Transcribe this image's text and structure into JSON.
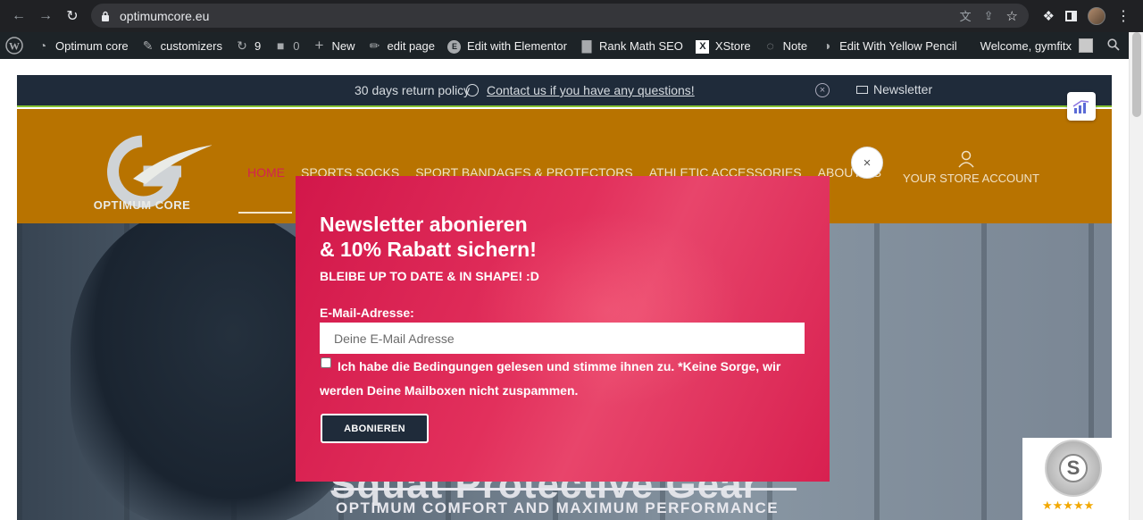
{
  "browser": {
    "url": "optimumcore.eu"
  },
  "adminbar": {
    "site_name": "Optimum core",
    "customizers": "customizers",
    "updates_count": "9",
    "comments_count": "0",
    "new": "New",
    "edit_page": "edit page",
    "elementor": "Edit with Elementor",
    "rankmath": "Rank Math SEO",
    "xstore": "XStore",
    "note": "Note",
    "yellow_pencil": "Edit With Yellow Pencil",
    "welcome": "Welcome, gymfitx"
  },
  "topbar": {
    "policy": "30 days return policy",
    "contact": "Contact us if you have any questions!",
    "newsletter": "Newsletter"
  },
  "header": {
    "logo_text": "OPTIMUM CORE",
    "menu": [
      "HOME",
      "SPORTS SOCKS",
      "SPORT BANDAGES & PROTECTORS",
      "ATHLETIC ACCESSORIES",
      "ABOUT US"
    ],
    "account": "YOUR STORE ACCOUNT"
  },
  "hero": {
    "title": "Squat Protective Gear",
    "subtitle": "OPTIMUM COMFORT AND MAXIMUM PERFORMANCE"
  },
  "popup": {
    "title_line1": "Newsletter abonieren",
    "title_line2": "& 10% Rabatt sichern!",
    "subtitle": "BLEIBE UP TO DATE & IN SHAPE! :D",
    "email_label": "E-Mail-Adresse:",
    "email_placeholder": "Deine E-Mail Adresse",
    "terms": "Ich habe die Bedingungen gelesen und stimme ihnen zu. *Keine Sorge, wir werden Deine Mailboxen nicht zuspammen.",
    "button": "ABONIEREN",
    "close": "×"
  },
  "shopvote": {
    "letter": "S",
    "stars": "★★★★★"
  }
}
